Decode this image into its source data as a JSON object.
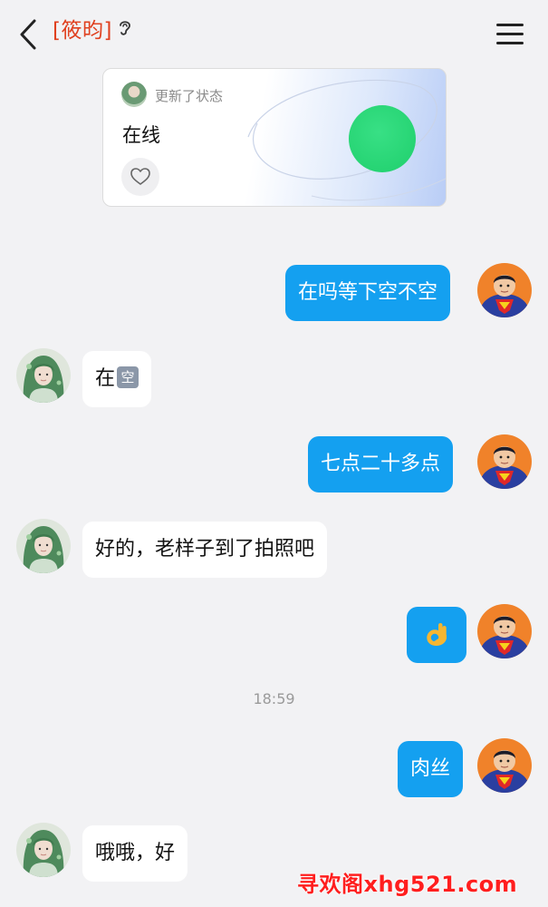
{
  "header": {
    "contact_name": "[筱昀]",
    "icons": {
      "back": "back-chevron-icon",
      "ear": "ear-icon",
      "menu": "menu-icon"
    }
  },
  "status_card": {
    "updated_label": "更新了状态",
    "status_text": "在线",
    "status_color": "#22d46f",
    "like_icon": "heart-icon"
  },
  "messages": [
    {
      "side": "right",
      "text": "在吗等下空不空"
    },
    {
      "side": "left",
      "text": "在",
      "glyph": "空"
    },
    {
      "side": "right",
      "text": "七点二十多点"
    },
    {
      "side": "left",
      "text": "好的，老样子到了拍照吧"
    },
    {
      "side": "right",
      "emoji": "ok-hand-emoji"
    },
    {
      "side": "right",
      "text": "肉丝"
    },
    {
      "side": "left",
      "text": "哦哦，好"
    }
  ],
  "timestamp": "18:59",
  "watermark": "寻欢阁xhg521.com",
  "colors": {
    "background": "#f2f2f4",
    "sent_bubble": "#14a0f0",
    "received_bubble": "#ffffff",
    "contact_name": "#e0401f"
  }
}
